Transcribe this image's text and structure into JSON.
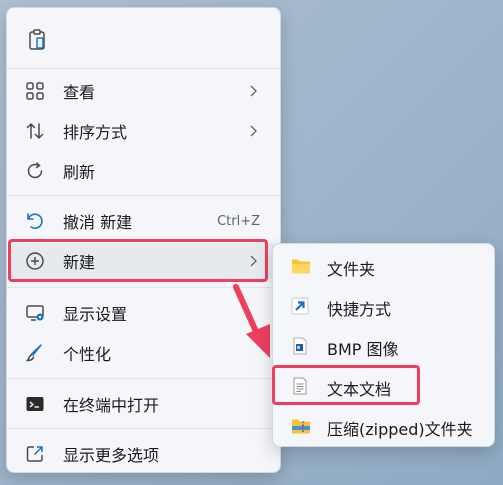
{
  "menu": {
    "paste_icon": "clipboard-icon",
    "items": [
      {
        "id": "view",
        "label": "查看",
        "icon": "grid-icon",
        "has_submenu": true
      },
      {
        "id": "sort",
        "label": "排序方式",
        "icon": "sort-icon",
        "has_submenu": true
      },
      {
        "id": "refresh",
        "label": "刷新",
        "icon": "refresh-icon",
        "has_submenu": false
      },
      {
        "id": "undo",
        "label": "撤消 新建",
        "shortcut": "Ctrl+Z",
        "icon": "undo-icon",
        "has_submenu": false
      },
      {
        "id": "new",
        "label": "新建",
        "icon": "plus-circle-icon",
        "has_submenu": true,
        "highlighted": true
      },
      {
        "id": "display",
        "label": "显示设置",
        "icon": "display-settings-icon",
        "has_submenu": false
      },
      {
        "id": "personalize",
        "label": "个性化",
        "icon": "brush-icon",
        "has_submenu": false
      },
      {
        "id": "terminal",
        "label": "在终端中打开",
        "icon": "terminal-icon",
        "has_submenu": false
      },
      {
        "id": "more",
        "label": "显示更多选项",
        "icon": "more-options-icon",
        "has_submenu": false
      }
    ]
  },
  "submenu": {
    "items": [
      {
        "id": "folder",
        "label": "文件夹",
        "icon": "folder-icon"
      },
      {
        "id": "shortcut",
        "label": "快捷方式",
        "icon": "shortcut-arrow-icon"
      },
      {
        "id": "bmp",
        "label": "BMP 图像",
        "icon": "bmp-image-icon"
      },
      {
        "id": "text",
        "label": "文本文档",
        "icon": "text-document-icon",
        "highlighted": true
      },
      {
        "id": "zip",
        "label": "压缩(zipped)文件夹",
        "icon": "zip-folder-icon"
      }
    ]
  },
  "colors": {
    "accent_red": "#ef3f5f",
    "menu_bg": "#f4f6f9",
    "highlight": "#e6e9ee"
  }
}
